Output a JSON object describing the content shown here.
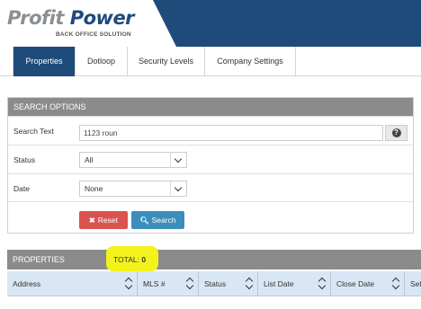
{
  "brand": {
    "logo_word1": "Profit",
    "logo_word2": "Power",
    "subtitle": "BACK OFFICE SOLUTION",
    "primary_color": "#1e4b7a"
  },
  "nav": {
    "tabs": [
      {
        "label": "Properties",
        "active": true
      },
      {
        "label": "Dotloop",
        "active": false
      },
      {
        "label": "Security Levels",
        "active": false
      },
      {
        "label": "Company Settings",
        "active": false
      }
    ]
  },
  "search": {
    "header": "SEARCH OPTIONS",
    "text_label": "Search Text",
    "text_value": "1123 roun",
    "help_icon": "question-circle-icon",
    "status_label": "Status",
    "status_value": "All",
    "date_label": "Date",
    "date_value": "None",
    "reset_label": "Reset",
    "reset_icon": "close-icon",
    "search_label": "Search",
    "search_icon": "magnifier-icon",
    "reset_color": "#d9534f",
    "search_color": "#3c8dbc"
  },
  "properties": {
    "header": "PROPERTIES",
    "total_label": "TOTAL:",
    "total_value": "0",
    "highlight_color": "#f3f31c",
    "columns": [
      "Address",
      "MLS #",
      "Status",
      "List Date",
      "Close Date",
      "Sell"
    ]
  }
}
